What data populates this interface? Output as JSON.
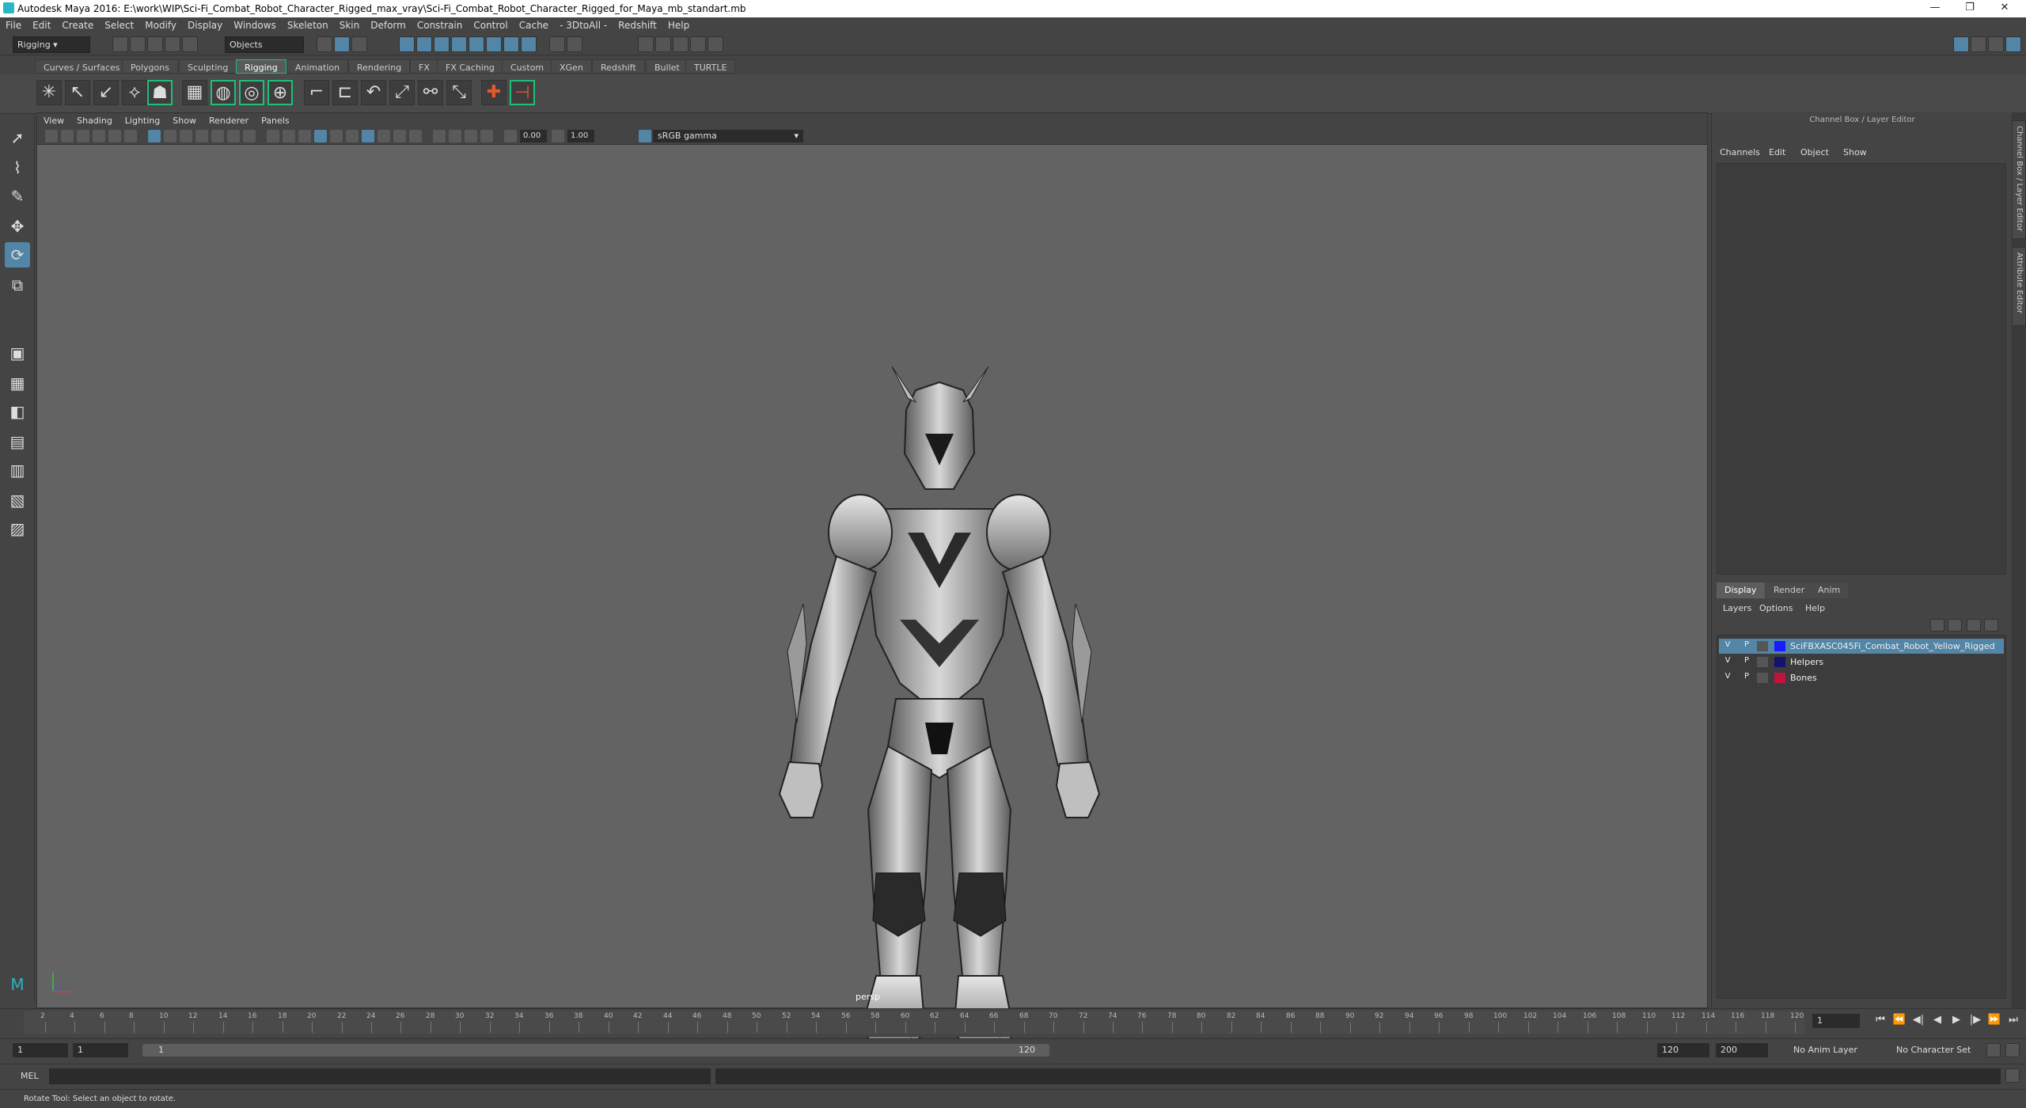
{
  "titlebar": {
    "title": "Autodesk Maya 2016: E:\\work\\WIP\\Sci-Fi_Combat_Robot_Character_Rigged_max_vray\\Sci-Fi_Combat_Robot_Character_Rigged_for_Maya_mb_standart.mb",
    "minimize": "—",
    "restore": "❐",
    "close": "✕"
  },
  "menubar": [
    "File",
    "Edit",
    "Create",
    "Select",
    "Modify",
    "Display",
    "Windows",
    "Skeleton",
    "Skin",
    "Deform",
    "Constrain",
    "Control",
    "Cache",
    "- 3DtoAll -",
    "Redshift",
    "Help"
  ],
  "status": {
    "menuset": "Rigging",
    "selmode": "Objects"
  },
  "shelf_tabs": [
    "Curves / Surfaces",
    "Polygons",
    "Sculpting",
    "Rigging",
    "Animation",
    "Rendering",
    "FX",
    "FX Caching",
    "Custom",
    "XGen",
    "Redshift",
    "Bullet",
    "TURTLE"
  ],
  "shelf_selected": "Rigging",
  "viewport": {
    "menu": [
      "View",
      "Shading",
      "Lighting",
      "Show",
      "Renderer",
      "Panels"
    ],
    "exposure": "0.00",
    "gamma_val": "1.00",
    "colorspace": "sRGB gamma",
    "camera": "persp"
  },
  "channelbox": {
    "title": "Channel Box / Layer Editor",
    "menu": [
      "Channels",
      "Edit",
      "Object",
      "Show"
    ]
  },
  "layers": {
    "tabs": [
      "Display",
      "Render",
      "Anim"
    ],
    "menu": [
      "Layers",
      "Options",
      "Help"
    ],
    "rows": [
      {
        "v": "V",
        "p": "P",
        "name": "SciFBXASC045Fi_Combat_Robot_Yellow_Rigged",
        "color": "#1a1aff"
      },
      {
        "v": "V",
        "p": "P",
        "name": "Helpers",
        "color": "#141470"
      },
      {
        "v": "V",
        "p": "P",
        "name": "Bones",
        "color": "#c0143c"
      }
    ]
  },
  "side_tabs": [
    "Channel Box / Layer Editor",
    "Attribute Editor"
  ],
  "timeline": {
    "ticks": [
      "2",
      "4",
      "6",
      "8",
      "10",
      "12",
      "14",
      "16",
      "18",
      "20",
      "22",
      "24",
      "26",
      "28",
      "30",
      "32",
      "34",
      "36",
      "38",
      "40",
      "42",
      "44",
      "46",
      "48",
      "50",
      "52",
      "54",
      "56",
      "58",
      "60",
      "62",
      "64",
      "66",
      "68",
      "70",
      "72",
      "74",
      "76",
      "78",
      "80",
      "82",
      "84",
      "86",
      "88",
      "90",
      "92",
      "94",
      "96",
      "98",
      "100",
      "102",
      "104",
      "106",
      "108",
      "110",
      "112",
      "114",
      "116",
      "118",
      "120"
    ],
    "first": "1",
    "current": "1"
  },
  "range": {
    "start": "1",
    "start2": "1",
    "bar_start": "1",
    "bar_end": "120",
    "end": "120",
    "end2": "200",
    "anim_layer": "No Anim Layer",
    "char_set": "No Character Set"
  },
  "cmdline": {
    "label": "MEL"
  },
  "helpline": "Rotate Tool: Select an object to rotate."
}
